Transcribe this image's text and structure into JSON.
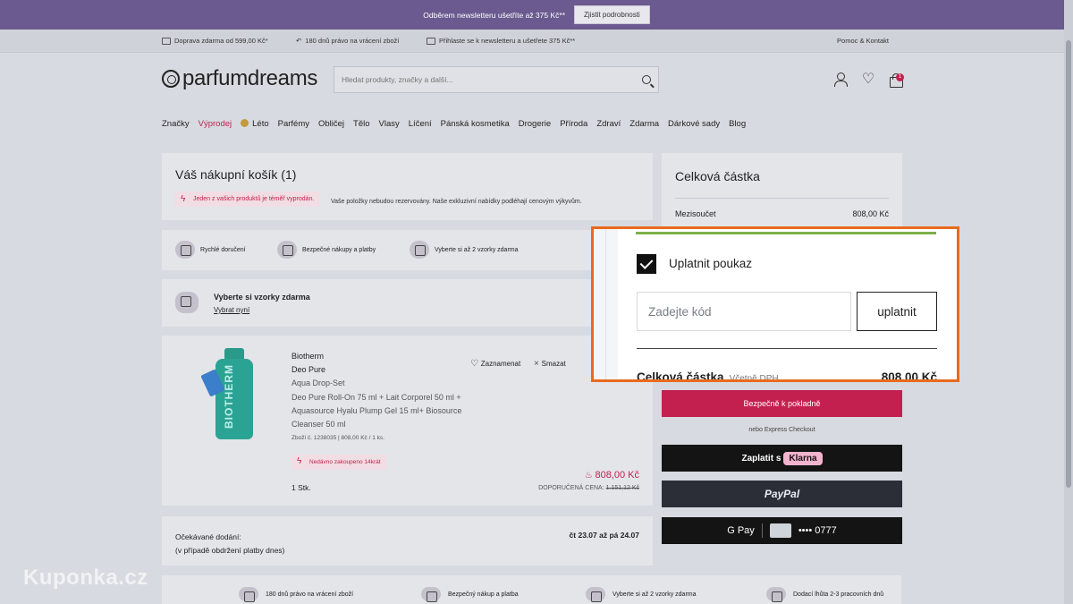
{
  "promo": {
    "text": "Odběrem newsletteru ušetříte až 375 Kč**",
    "button": "Zjistit podrobnosti"
  },
  "usp": {
    "items": [
      "Doprava zdarma od 599,00 Kč*",
      "180 dnů právo na vrácení zboží",
      "Přihlaste se k newsletteru a ušetřete 375 Kč**"
    ],
    "help": "Pomoc & Kontakt"
  },
  "header": {
    "logo": "parfumdreams",
    "search_placeholder": "Hledat produkty, značky a další...",
    "cart_count": "1",
    "icons": [
      "user-icon",
      "heart-icon",
      "cart-icon",
      "search-icon"
    ]
  },
  "nav": {
    "items": [
      "Značky",
      "Výprodej",
      "Léto",
      "Parfémy",
      "Obličej",
      "Tělo",
      "Vlasy",
      "Líčení",
      "Pánská kosmetika",
      "Drogerie",
      "Příroda",
      "Zdraví",
      "Zdarma",
      "Dárkové sady",
      "Blog"
    ],
    "sale_color": "#c4204f"
  },
  "cart": {
    "title": "Váš nákupní košík (1)",
    "stock_badge": "Jeden z vašich produktů je téměř vyprodán.",
    "stock_note": "Vaše položky nebudou rezervovány. Naše exkluzivní nabídky podléhají cenovým výkyvům.",
    "benefits": [
      "Rychlé doručení",
      "Bezpečné nákupy a platby",
      "Vyberte si až 2 vzorky zdarma"
    ],
    "samples_title": "Vyberte si vzorky zdarma",
    "samples_link": "Vybrat nyní"
  },
  "product": {
    "brand": "Biotherm",
    "line": "Deo Pure",
    "set_name": "Aqua Drop-Set",
    "description": "Deo Pure Roll-On 75 ml + Lait Corporel 50 ml + Aquasource Hyalu Plump Gel 15 ml+ Biosource Cleanser 50 ml",
    "meta": "Zboží č. 1238035 | 808,00 Kč / 1 ks.",
    "hot_badge": "Nedávno zakoupeno 14krát",
    "quantity": "1 Stk.",
    "save_label": "Zaznamenat",
    "delete_label": "Smazat",
    "price": "808,00 Kč",
    "rrp_label": "DOPORUČENÁ CENA:",
    "rrp_old": "1.151,12 Kč",
    "bottle_text": "BIOTHERM"
  },
  "delivery": {
    "label_line1": "Očekávané dodání:",
    "label_line2": "(v případě obdržení platby dnes)",
    "date": "čt 23.07 až pá 24.07"
  },
  "bottom_usp": [
    "180 dnů právo na vrácení zboží",
    "Bezpečný nákup a platba",
    "Vyberte si až 2 vzorky zdarma",
    "Dodací lhůta 2-3 pracovních dnů"
  ],
  "summary": {
    "title": "Celková částka",
    "subtotal_label": "Mezisoučet",
    "subtotal_value": "808,00 Kč",
    "checkout": "Bezpečně k pokladně",
    "express": "nebo Express Checkout",
    "klarna_prefix": "Zaplatit s",
    "klarna_logo": "Klarna",
    "paypal": "PayPal",
    "gpay": "G Pay",
    "gpay_card": "•••• 0777"
  },
  "voucher": {
    "checkbox_label": "Uplatnit poukaz",
    "checked": true,
    "input_placeholder": "Zadejte kód",
    "apply_button": "uplatnit",
    "total_label": "Celková částka",
    "total_vat": "Včetně DPH",
    "total_value": "808,00 Kč",
    "progress_color": "#7db04a",
    "highlight_color": "#e86a1e"
  },
  "watermark": "Kuponka.cz"
}
